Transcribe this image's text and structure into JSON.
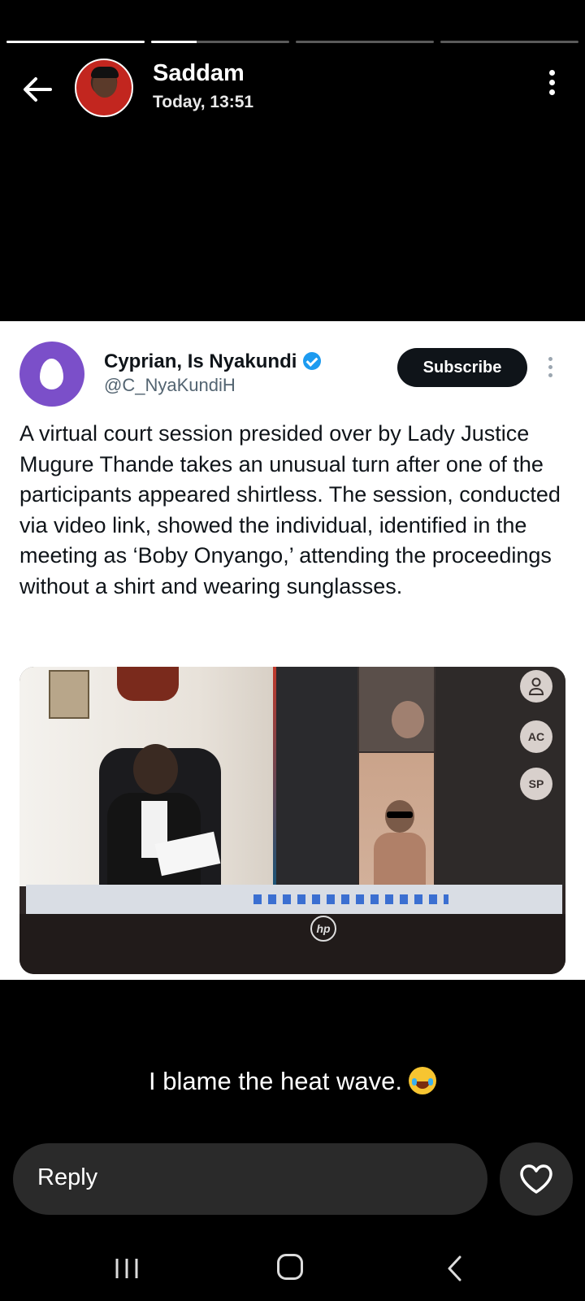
{
  "story": {
    "progress": [
      1.0,
      0.33,
      0.0,
      0.0
    ],
    "user_name": "Saddam",
    "timestamp": "Today, 13:51",
    "caption": "I blame the heat wave.",
    "caption_emoji": "face-with-tears-of-joy-icon"
  },
  "tweet": {
    "author": "Cyprian, Is Nyakundi",
    "handle": "@C_NyaKundiH",
    "verified": true,
    "subscribe_label": "Subscribe",
    "body": "A virtual court session presided over by Lady Justice Mugure Thande takes an unusual turn after one of the participants appeared shirtless. The session, conducted via video link, showed the individual, identified in the meeting as ‘Boby Onyango,’ attending the proceedings without a shirt and wearing sunglasses.",
    "media": {
      "participant_badges": [
        "AC",
        "SP"
      ],
      "brand": "hp"
    }
  },
  "reply": {
    "placeholder": "Reply"
  },
  "colors": {
    "background": "#000000",
    "card": "#ffffff",
    "subscribe_button": "#0f1419",
    "verified": "#1d9bf0",
    "default_avatar": "#7b4fc9",
    "reply_bar": "#2a2a2a"
  }
}
